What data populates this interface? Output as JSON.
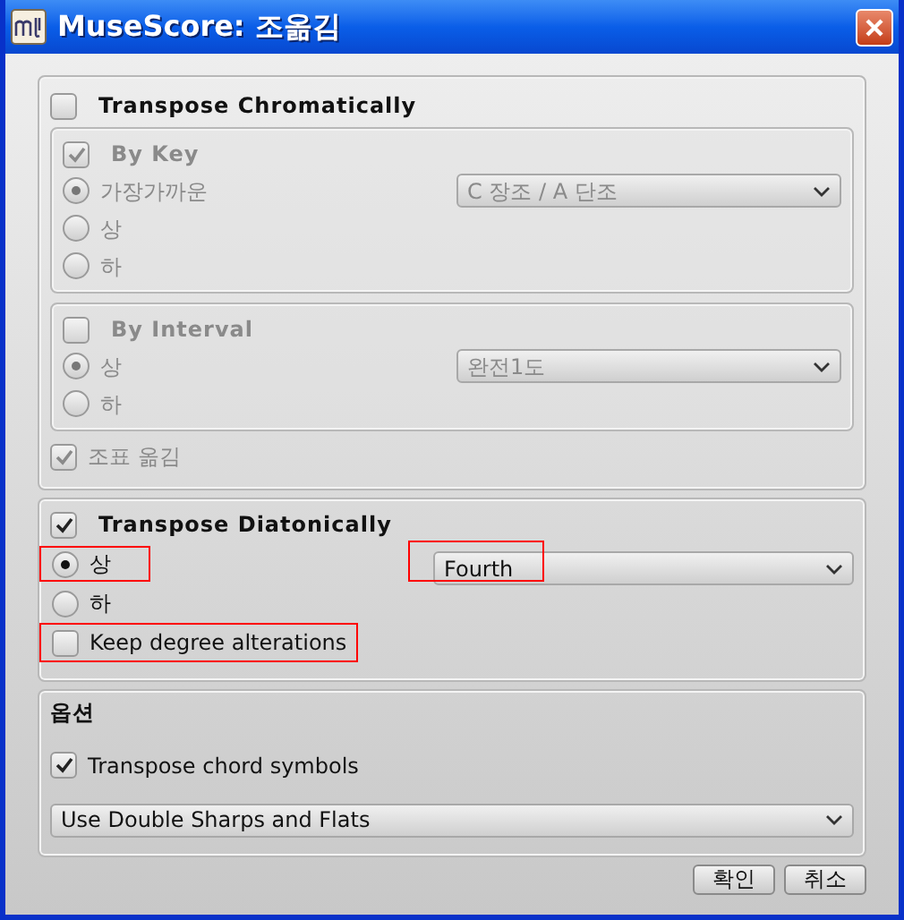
{
  "window": {
    "title": "MuseScore: 조옮김"
  },
  "chromatic": {
    "label": "Transpose Chromatically",
    "checked": false,
    "by_key": {
      "label": "By Key",
      "checked": true,
      "disabled": true,
      "options": [
        {
          "label": "가장가까운",
          "selected": true
        },
        {
          "label": "상",
          "selected": false
        },
        {
          "label": "하",
          "selected": false
        }
      ],
      "dropdown": {
        "value": "C 장조 / A 단조"
      }
    },
    "by_interval": {
      "label": "By Interval",
      "checked": false,
      "disabled": true,
      "options": [
        {
          "label": "상",
          "selected": true
        },
        {
          "label": "하",
          "selected": false
        }
      ],
      "dropdown": {
        "value": "완전1도"
      }
    },
    "transpose_key_signature": {
      "label": "조표 옮김",
      "checked": true,
      "disabled": true
    }
  },
  "diatonic": {
    "label": "Transpose Diatonically",
    "checked": true,
    "options": [
      {
        "label": "상",
        "selected": true,
        "highlighted": true
      },
      {
        "label": "하",
        "selected": false,
        "highlighted": false
      }
    ],
    "dropdown": {
      "value": "Fourth",
      "highlighted": true
    },
    "keep_degree_alterations": {
      "label": "Keep degree alterations",
      "checked": false,
      "highlighted": true
    }
  },
  "options": {
    "title": "옵션",
    "transpose_chord_symbols": {
      "label": "Transpose chord symbols",
      "checked": true
    },
    "dropdown": {
      "value": "Use Double Sharps and Flats"
    }
  },
  "buttons": [
    "확인",
    "취소"
  ]
}
